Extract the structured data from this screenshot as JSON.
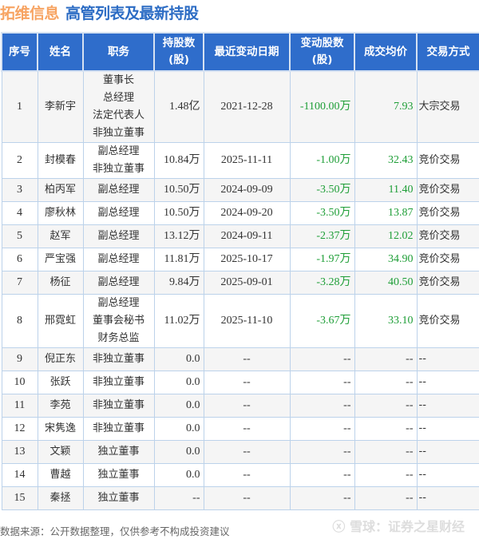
{
  "title": {
    "company": "拓维信息",
    "subtitle": "高管列表及最新持股"
  },
  "colors": {
    "header_bg": "#2f6dcb",
    "company": "#f7a463",
    "subtitle": "#2c6cc4",
    "change": "#1e9e37"
  },
  "columns": [
    "序号",
    "姓名",
    "职务",
    "持股数\n(股)",
    "最近变动日期",
    "变动股数\n(股)",
    "成交均价",
    "交易方式"
  ],
  "rows": [
    {
      "no": "1",
      "name": "李新宇",
      "roles": [
        "董事长",
        "总经理",
        "法定代表人",
        "非独立董事"
      ],
      "shares": "1.48亿",
      "date": "2021-12-28",
      "change": "-1100.00万",
      "price": "7.93",
      "method": "大宗交易"
    },
    {
      "no": "2",
      "name": "封模春",
      "roles": [
        "副总经理",
        "非独立董事"
      ],
      "shares": "10.84万",
      "date": "2025-11-11",
      "change": "-1.00万",
      "price": "32.43",
      "method": "竞价交易"
    },
    {
      "no": "3",
      "name": "柏丙军",
      "roles": [
        "副总经理"
      ],
      "shares": "10.50万",
      "date": "2024-09-09",
      "change": "-3.50万",
      "price": "11.40",
      "method": "竞价交易"
    },
    {
      "no": "4",
      "name": "廖秋林",
      "roles": [
        "副总经理"
      ],
      "shares": "10.50万",
      "date": "2024-09-20",
      "change": "-3.50万",
      "price": "13.87",
      "method": "竞价交易"
    },
    {
      "no": "5",
      "name": "赵军",
      "roles": [
        "副总经理"
      ],
      "shares": "13.12万",
      "date": "2024-09-11",
      "change": "-2.37万",
      "price": "12.02",
      "method": "竞价交易"
    },
    {
      "no": "6",
      "name": "严宝强",
      "roles": [
        "副总经理"
      ],
      "shares": "11.81万",
      "date": "2025-10-17",
      "change": "-1.97万",
      "price": "34.90",
      "method": "竞价交易"
    },
    {
      "no": "7",
      "name": "杨征",
      "roles": [
        "副总经理"
      ],
      "shares": "9.84万",
      "date": "2025-09-01",
      "change": "-3.28万",
      "price": "40.50",
      "method": "竞价交易"
    },
    {
      "no": "8",
      "name": "邢霓虹",
      "roles": [
        "副总经理",
        "董事会秘书",
        "财务总监"
      ],
      "shares": "11.02万",
      "date": "2025-11-10",
      "change": "-3.67万",
      "price": "33.10",
      "method": "竞价交易"
    },
    {
      "no": "9",
      "name": "倪正东",
      "roles": [
        "非独立董事"
      ],
      "shares": "0.0",
      "date": "--",
      "change": "--",
      "price": "--",
      "method": "--"
    },
    {
      "no": "10",
      "name": "张跃",
      "roles": [
        "非独立董事"
      ],
      "shares": "0.0",
      "date": "--",
      "change": "--",
      "price": "--",
      "method": "--"
    },
    {
      "no": "11",
      "name": "李苑",
      "roles": [
        "非独立董事"
      ],
      "shares": "0.0",
      "date": "--",
      "change": "--",
      "price": "--",
      "method": "--"
    },
    {
      "no": "12",
      "name": "宋隽逸",
      "roles": [
        "非独立董事"
      ],
      "shares": "0.0",
      "date": "--",
      "change": "--",
      "price": "--",
      "method": "--"
    },
    {
      "no": "13",
      "name": "文颖",
      "roles": [
        "独立董事"
      ],
      "shares": "0.0",
      "date": "--",
      "change": "--",
      "price": "--",
      "method": "--"
    },
    {
      "no": "14",
      "name": "曹越",
      "roles": [
        "独立董事"
      ],
      "shares": "0.0",
      "date": "--",
      "change": "--",
      "price": "--",
      "method": "--"
    },
    {
      "no": "15",
      "name": "秦拯",
      "roles": [
        "独立董事"
      ],
      "shares": "--",
      "date": "--",
      "change": "--",
      "price": "--",
      "method": "--"
    }
  ],
  "footer": {
    "source": "数据来源：公开数据整理，仅供参考不构成投资建议",
    "watermark": "雪球：证券之星财经"
  }
}
